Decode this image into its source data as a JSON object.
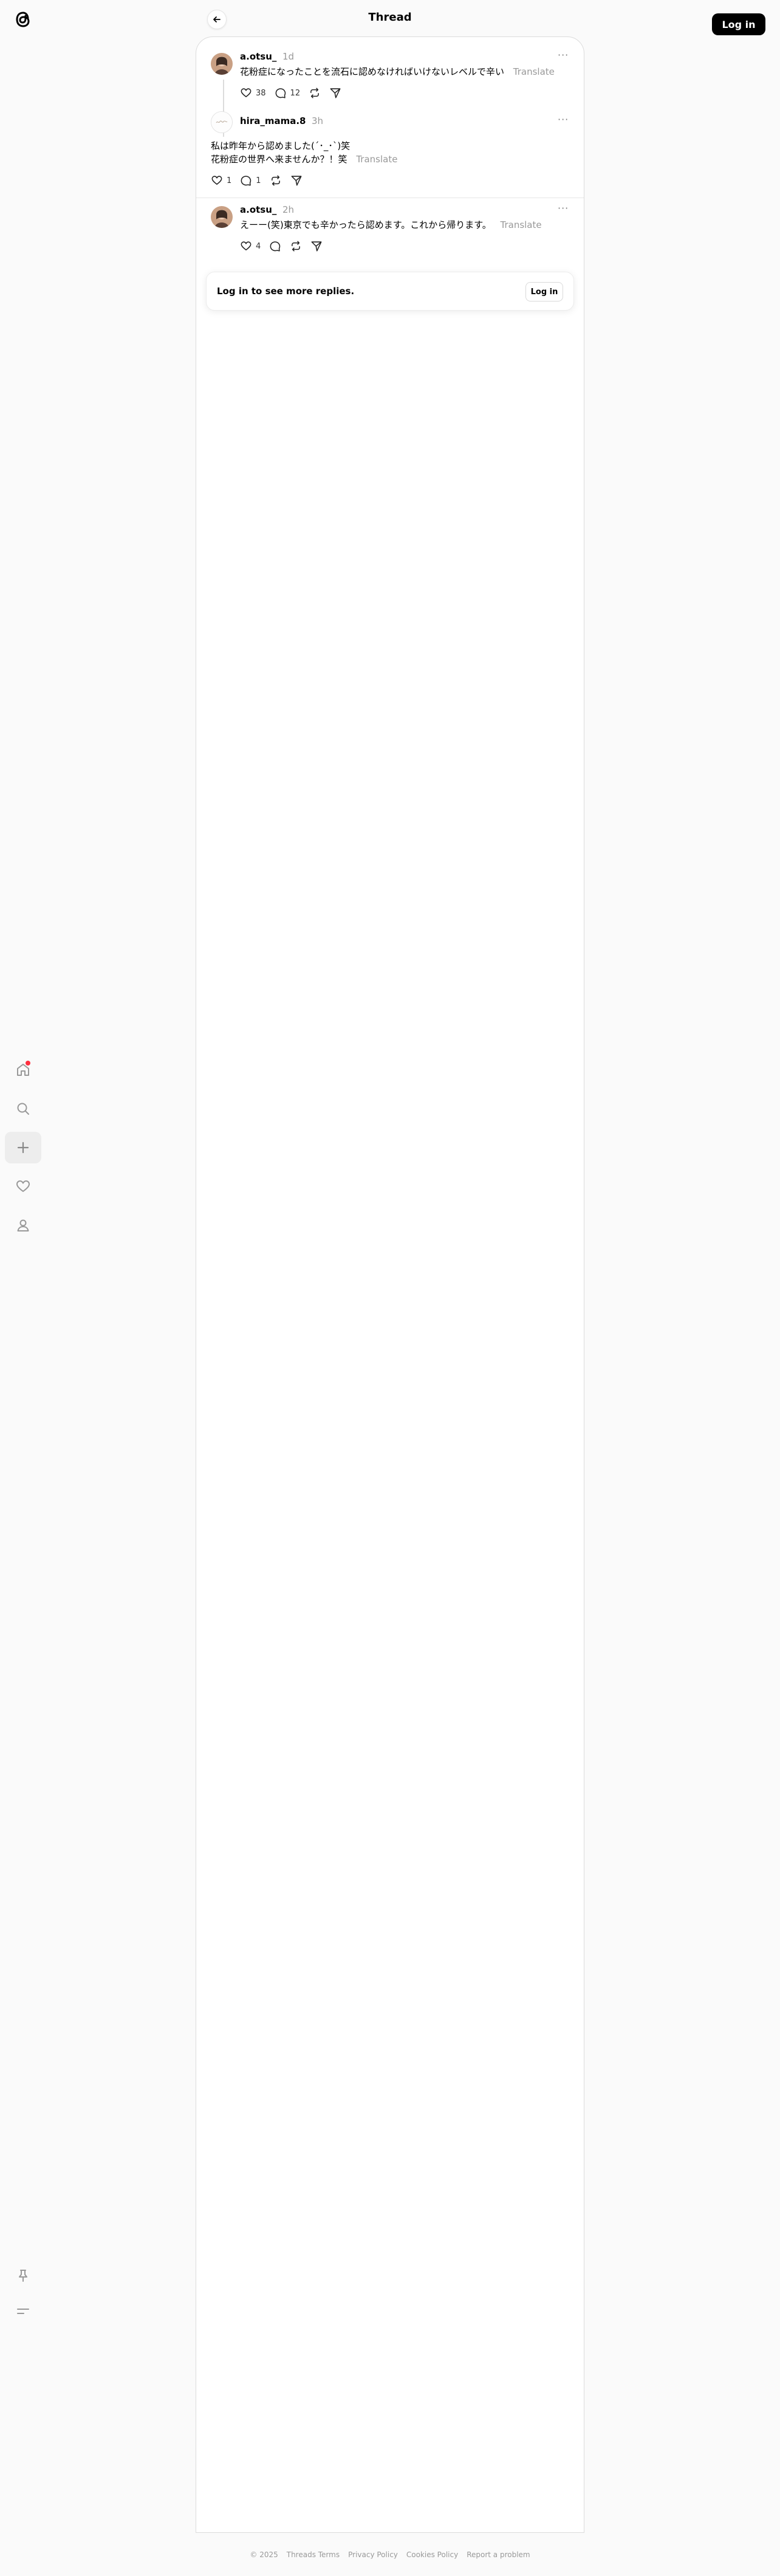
{
  "header": {
    "title": "Thread",
    "login_label": "Log in"
  },
  "sidebar": {
    "items": [
      {
        "name": "home",
        "icon": "home-icon"
      },
      {
        "name": "search",
        "icon": "search-icon"
      },
      {
        "name": "create",
        "icon": "plus-icon"
      },
      {
        "name": "activity",
        "icon": "heart-icon"
      },
      {
        "name": "profile",
        "icon": "user-icon"
      }
    ],
    "bottom": [
      {
        "name": "pin",
        "icon": "pin-icon"
      },
      {
        "name": "menu",
        "icon": "menu-icon"
      }
    ]
  },
  "posts": [
    {
      "username": "a.otsu_",
      "time": "1d",
      "text": "花粉症になったことを流石に認めなければいけないレベルで辛い",
      "translate": "Translate",
      "likes": "38",
      "replies": "12"
    },
    {
      "username": "hira_mama.8",
      "time": "3h",
      "lines": [
        "私は昨年から認めました(´･_･`)笑",
        "花粉症の世界へ来ませんか？！笑"
      ],
      "translate": "Translate",
      "likes": "1",
      "replies": "1"
    },
    {
      "username": "a.otsu_",
      "time": "2h",
      "text": "えーー(笑)東京でも辛かったら認めます。これから帰ります。",
      "translate": "Translate",
      "likes": "4",
      "replies": ""
    }
  ],
  "login_prompt": {
    "message": "Log in to see more replies.",
    "button": "Log in"
  },
  "footer": {
    "copyright": "© 2025",
    "links": [
      "Threads Terms",
      "Privacy Policy",
      "Cookies Policy",
      "Report a problem"
    ]
  },
  "colors": {
    "background": "#fafafa",
    "card": "#ffffff",
    "notification": "#ff3040",
    "muted": "#999999"
  }
}
